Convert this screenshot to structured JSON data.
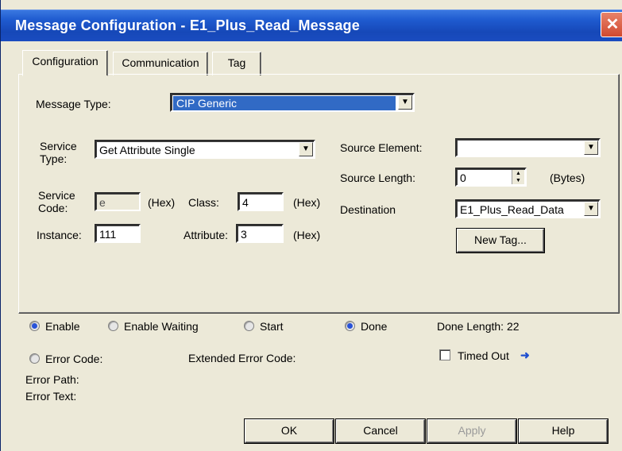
{
  "window": {
    "title": "Message Configuration - E1_Plus_Read_Message",
    "close_glyph": "✕"
  },
  "tabs": [
    {
      "label": "Configuration",
      "active": true
    },
    {
      "label": "Communication",
      "active": false
    },
    {
      "label": "Tag",
      "active": false
    }
  ],
  "config": {
    "message_type_label": "Message Type:",
    "message_type_value": "CIP Generic",
    "service_type_label_line1": "Service",
    "service_type_label_line2": "Type:",
    "service_type_value": "Get Attribute Single",
    "service_code_label_line1": "Service",
    "service_code_label_line2": "Code:",
    "service_code_value": "e",
    "hex1": "(Hex)",
    "class_label": "Class:",
    "class_value": "4",
    "hex2": "(Hex)",
    "instance_label": "Instance:",
    "instance_value": "111",
    "attribute_label": "Attribute:",
    "attribute_value": "3",
    "hex3": "(Hex)",
    "source_element_label": "Source Element:",
    "source_element_value": "",
    "source_length_label": "Source Length:",
    "source_length_value": "0",
    "bytes_label": "(Bytes)",
    "destination_label": "Destination",
    "destination_value": "E1_Plus_Read_Data",
    "new_tag_button": "New Tag..."
  },
  "status": {
    "enable": {
      "label": "Enable",
      "on": true
    },
    "enable_waiting": {
      "label": "Enable Waiting",
      "on": false
    },
    "start": {
      "label": "Start",
      "on": false
    },
    "done": {
      "label": "Done",
      "on": true
    },
    "done_length": "Done Length: 22",
    "error_code": {
      "label": "Error Code:",
      "on": false
    },
    "extended_error_code_label": "Extended Error Code:",
    "timed_out": {
      "label": "Timed Out",
      "checked": false
    },
    "error_path_label": "Error Path:",
    "error_text_label": "Error Text:"
  },
  "buttons": {
    "ok": "OK",
    "cancel": "Cancel",
    "apply": "Apply",
    "help": "Help"
  },
  "icons": {
    "timed_out_arrow": "left-arrow-icon",
    "radio_on_color": "#2852d8",
    "titlebar_color": "#1a4cc0"
  }
}
